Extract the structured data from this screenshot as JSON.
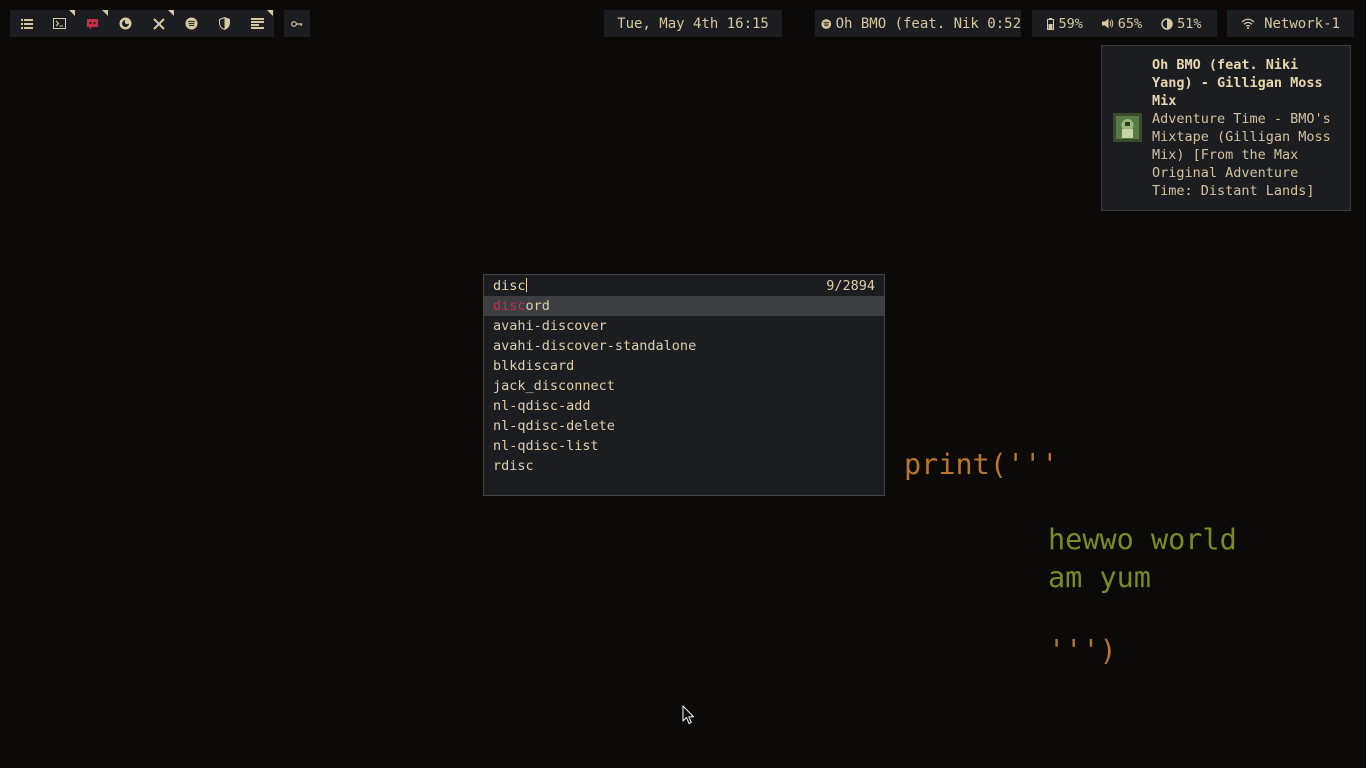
{
  "bar": {
    "workspaces": [
      {
        "icon": "list-icon",
        "marked": false
      },
      {
        "icon": "terminal-icon",
        "marked": true
      },
      {
        "icon": "discord-icon",
        "marked": true
      },
      {
        "icon": "firefox-icon",
        "marked": false
      },
      {
        "icon": "tools-icon",
        "marked": true
      },
      {
        "icon": "spotify-icon",
        "marked": false
      },
      {
        "icon": "shield-icon",
        "marked": false
      },
      {
        "icon": "media-icon",
        "marked": true
      }
    ],
    "clock": "Tue, May 4th 16:15",
    "media": "Oh BMO (feat. Nik 0:52",
    "battery": "59%",
    "volume": "65%",
    "brightness": "51%",
    "network": "Network-1"
  },
  "notification": {
    "title": "Oh BMO (feat. Niki Yang) - Gilligan Moss Mix",
    "body": "Adventure Time - BMO's Mixtape (Gilligan Moss Mix) [From the Max Original Adventure Time: Distant Lands]"
  },
  "launcher": {
    "query": "disc",
    "count": "9/2894",
    "selected_index": 0,
    "results": [
      {
        "match": "disc",
        "rest": "ord"
      },
      {
        "match": "",
        "rest": "avahi-discover"
      },
      {
        "match": "",
        "rest": "avahi-discover-standalone"
      },
      {
        "match": "",
        "rest": "blkdiscard"
      },
      {
        "match": "",
        "rest": "jack_disconnect"
      },
      {
        "match": "",
        "rest": "nl-qdisc-add"
      },
      {
        "match": "",
        "rest": "nl-qdisc-delete"
      },
      {
        "match": "",
        "rest": "nl-qdisc-list"
      },
      {
        "match": "",
        "rest": "rdisc"
      }
    ]
  },
  "wallpaper": {
    "line1": "print('''",
    "line2": "hewwo world",
    "line3": "am yum",
    "line4": "''')"
  },
  "colors": {
    "bar_bg": "#1c1d21",
    "text": "#d9c7a0",
    "highlight": "#cc2d44",
    "code_orange": "#b5752c",
    "code_green": "#7a8b22"
  }
}
